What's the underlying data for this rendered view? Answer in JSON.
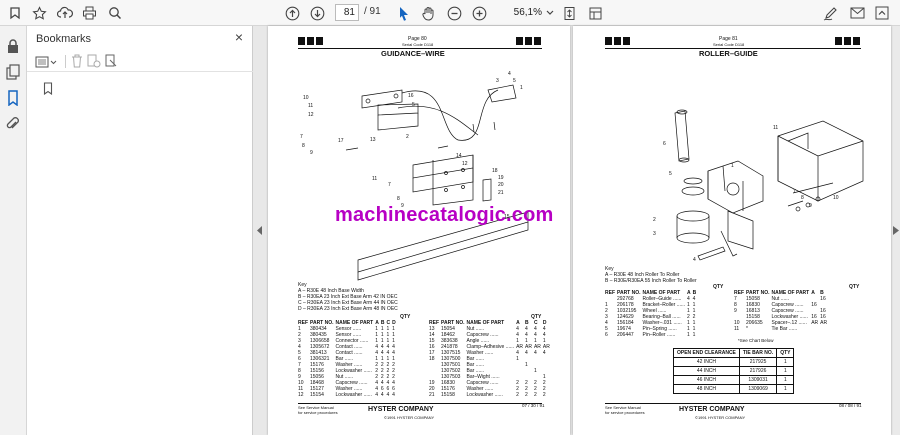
{
  "toolbar": {
    "current_page": "81",
    "total_pages": "/ 91",
    "zoom": "56,1%"
  },
  "panel": {
    "title": "Bookmarks",
    "close": "×"
  },
  "watermark": "machinecatalogic.com",
  "page80": {
    "page_label": "Page 80",
    "serial": "Serial Code D118",
    "title": "GUIDANCE–WIRE",
    "key_title": "Key",
    "key_lines": [
      "A – R30E 48 Inch Base Width",
      "B – R30EA 23 Inch Ext Base Arm 42 IN OEC",
      "C – R30EA 23 Inch Ext Base Arm 44 IN OEC",
      "D – R30EA 23 Inch Ext Base Arm 48 IN OEC"
    ],
    "qty_header": "QTY",
    "headers": [
      "REF",
      "PART NO.",
      "NAME OF PART",
      "A",
      "B",
      "C",
      "D"
    ],
    "rows_left": [
      [
        "1",
        "380434",
        "Sensor",
        "1",
        "1",
        "1",
        "1"
      ],
      [
        "2",
        "380435",
        "Sensor",
        "1",
        "1",
        "1",
        "1"
      ],
      [
        "3",
        "1306658",
        "Connector",
        "1",
        "1",
        "1",
        "1"
      ],
      [
        "4",
        "1305672",
        "Contact",
        "4",
        "4",
        "4",
        "4"
      ],
      [
        "5",
        "381413",
        "Contact",
        "4",
        "4",
        "4",
        "4"
      ],
      [
        "6",
        "1306321",
        "Bar",
        "1",
        "1",
        "1",
        "1"
      ],
      [
        "7",
        "15176",
        "Washer",
        "2",
        "2",
        "2",
        "2"
      ],
      [
        "8",
        "15156",
        "Lockwasher",
        "2",
        "2",
        "2",
        "2"
      ],
      [
        "9",
        "15056",
        "Nut",
        "2",
        "2",
        "2",
        "2"
      ],
      [
        "10",
        "18468",
        "Capscrew",
        "4",
        "4",
        "4",
        "4"
      ],
      [
        "11",
        "15127",
        "Washer",
        "4",
        "6",
        "6",
        "6"
      ],
      [
        "12",
        "15154",
        "Lockwasher",
        "4",
        "4",
        "4",
        "4"
      ]
    ],
    "rows_right": [
      [
        "13",
        "15054",
        "Nut",
        "4",
        "4",
        "4",
        "4"
      ],
      [
        "14",
        "18462",
        "Capscrew",
        "4",
        "4",
        "4",
        "4"
      ],
      [
        "15",
        "383638",
        "Angle",
        "1",
        "1",
        "1",
        "1"
      ],
      [
        "16",
        "241878",
        "Clamp–Adhesive",
        "AR",
        "AR",
        "AR",
        "AR"
      ],
      [
        "17",
        "1307515",
        "Washer",
        "4",
        "4",
        "4",
        "4"
      ],
      [
        "18",
        "1307500",
        "Bar",
        "1",
        "",
        "",
        ""
      ],
      [
        "",
        "1307501",
        "Bar",
        "",
        "1",
        "",
        ""
      ],
      [
        "",
        "1307502",
        "Bar",
        "",
        "",
        "1",
        ""
      ],
      [
        "",
        "1307503",
        "Bar–Wight",
        "",
        "",
        "",
        "1"
      ],
      [
        "19",
        "16830",
        "Capscrew",
        "2",
        "2",
        "2",
        "2"
      ],
      [
        "20",
        "15176",
        "Washer",
        "2",
        "2",
        "2",
        "2"
      ],
      [
        "21",
        "15158",
        "Lockwasher",
        "2",
        "2",
        "2",
        "2"
      ]
    ],
    "footer_left1": "See Service Manual",
    "footer_left2": "for service procedures",
    "company": "HYSTER COMPANY",
    "copyright": "©1991 HYSTER COMPANY",
    "date": "07 / 30 / 91",
    "callouts": [
      "10",
      "11",
      "12",
      "7",
      "8",
      "9",
      "17",
      "13",
      "2",
      "16",
      "5",
      "3",
      "4",
      "1",
      "14",
      "12",
      "18",
      "19",
      "20",
      "21",
      "15",
      "11",
      "7",
      "8",
      "9"
    ]
  },
  "page81": {
    "page_label": "Page 81",
    "serial": "Serial Code D118",
    "title": "ROLLER–GUIDE",
    "key_title": "Key",
    "key_lines": [
      "A – R30E 48 Inch Roller To Roller",
      "B – R30E/R30EA 55 Inch Roller To Roller"
    ],
    "qty_header": "QTY",
    "headers": [
      "REF",
      "PART NO.",
      "NAME OF PART",
      "A",
      "B"
    ],
    "rows_left": [
      [
        "",
        "292768",
        "Roller–Guide",
        "4",
        "4"
      ],
      [
        "1",
        "206178",
        "Bracket–Roller",
        "1",
        "1"
      ],
      [
        "2",
        "1032195",
        "Wheel",
        "1",
        "1"
      ],
      [
        "3",
        "124629",
        "Bearing–Ball",
        "2",
        "2"
      ],
      [
        "4",
        "156184",
        "Washer–.031",
        "1",
        "1"
      ],
      [
        "5",
        "19674",
        "Pin–Spring",
        "1",
        "1"
      ],
      [
        "6",
        "206447",
        "Pin–Roller",
        "1",
        "1"
      ]
    ],
    "rows_right": [
      [
        "7",
        "15058",
        "Nut",
        "",
        "16"
      ],
      [
        "8",
        "16830",
        "Capscrew",
        "16",
        ""
      ],
      [
        "9",
        "16813",
        "Capscrew",
        "",
        "16"
      ],
      [
        "",
        "15158",
        "Lockwasher",
        "16",
        "16"
      ],
      [
        "10",
        "206635",
        "Spacer–.12",
        "AR",
        "AR"
      ],
      [
        "11",
        "*",
        "Tie Bar",
        "",
        ""
      ]
    ],
    "see_chart": "*See Chart Below",
    "clear_headers": [
      "OPEN END CLEARANCE",
      "TIE BAR NO.",
      "QTY"
    ],
    "clear_rows": [
      [
        "42 INCH",
        "217925",
        "1"
      ],
      [
        "44 INCH",
        "217926",
        "1"
      ],
      [
        "46 INCH",
        "1309031",
        "1"
      ],
      [
        "48 INCH",
        "1309069",
        "1"
      ]
    ],
    "footer_left1": "See Service Manual",
    "footer_left2": "for service procedures",
    "company": "HYSTER COMPANY",
    "copyright": "©1991 HYSTER COMPANY",
    "date": "08 / 08 / 91",
    "callouts": [
      "11",
      "6",
      "5",
      "1",
      "2",
      "3",
      "4",
      "7",
      "8",
      "9",
      "10"
    ]
  }
}
